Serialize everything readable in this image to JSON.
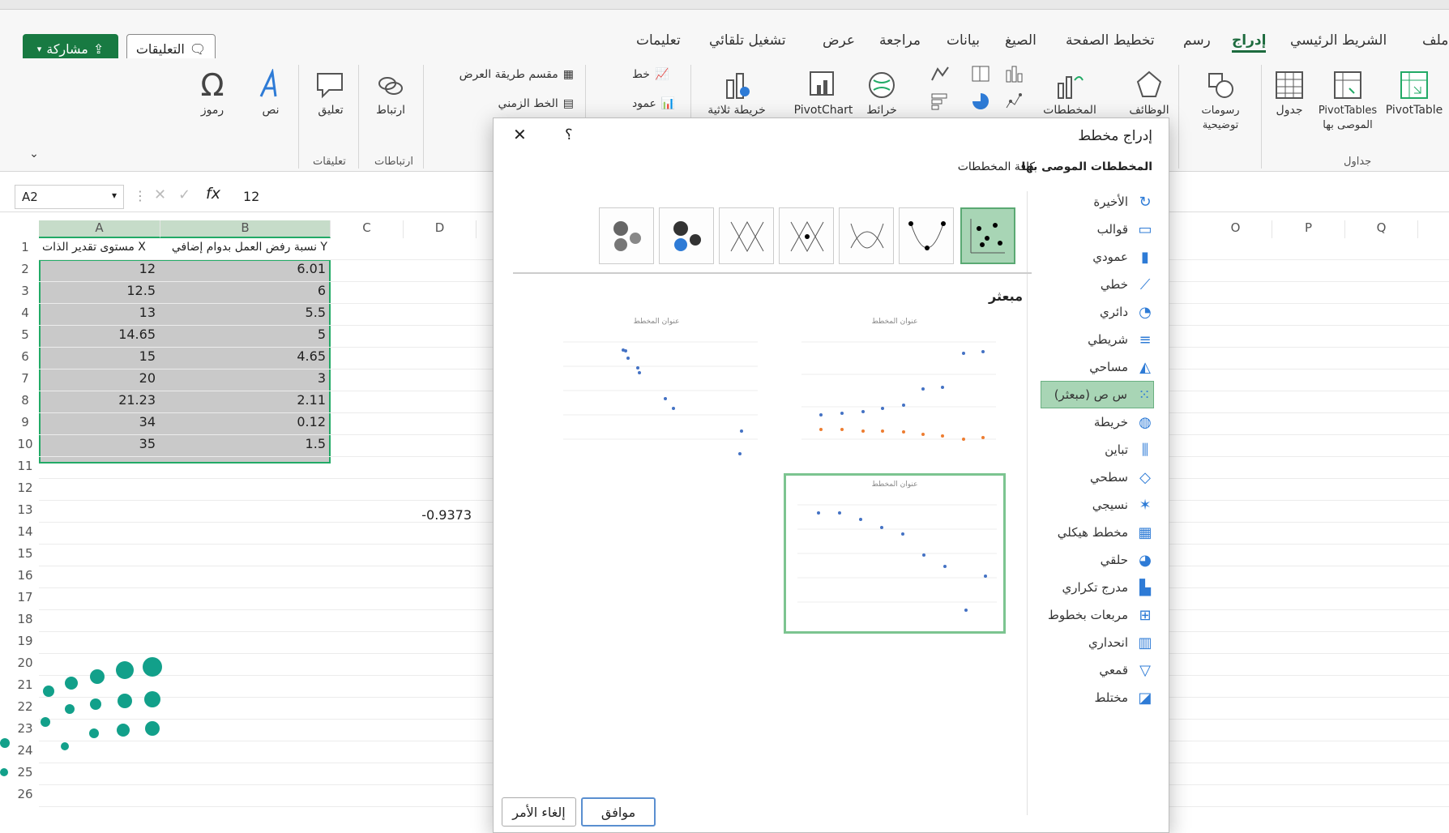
{
  "app": {
    "accent": "#187a42",
    "selection_green": "#a8d5b5"
  },
  "menu": {
    "tabs": [
      "ملف",
      "الشريط الرئيسي",
      "إدراج",
      "رسم",
      "تخطيط الصفحة",
      "الصيغ",
      "بيانات",
      "مراجعة",
      "عرض",
      "تشغيل تلقائي",
      "تعليمات"
    ],
    "active_tab": "إدراج",
    "share_label": "مشاركة",
    "comments_label": "التعليقات"
  },
  "ribbon": {
    "pivottable": "PivotTable",
    "recommended_pivottables": "PivotTables الموصى بها",
    "table": "جدول",
    "tables_group": "جداول",
    "illustrations": "رسومات توضيحية",
    "functions": "الوظائف",
    "charts": "المخططات",
    "maps": "خرائط",
    "pivotchart": "PivotChart",
    "3d_map": "خريطة ثلاثية",
    "line_spark": "خط",
    "column_spark": "عمود",
    "slicer": "مقسم طريقة العرض",
    "timeline": "الخط الزمني",
    "link": "ارتباط",
    "links_group": "ارتباطات",
    "comment": "تعليق",
    "comments_group": "تعليقات",
    "text": "نص",
    "symbols": "رموز"
  },
  "formula_bar": {
    "name_box": "A2",
    "fx": "fx",
    "value": "12"
  },
  "sheet": {
    "columns": [
      "A",
      "B",
      "C",
      "D",
      "O",
      "P",
      "Q"
    ],
    "header_a": "مستوى تقدير الذات X",
    "header_b": "نسبة رفض العمل بدوام إضافي Y",
    "rows": [
      {
        "a": "12",
        "b": "6.01"
      },
      {
        "a": "12.5",
        "b": "6"
      },
      {
        "a": "13",
        "b": "5.5"
      },
      {
        "a": "14.65",
        "b": "5"
      },
      {
        "a": "15",
        "b": "4.65"
      },
      {
        "a": "20",
        "b": "3"
      },
      {
        "a": "21.23",
        "b": "2.11"
      },
      {
        "a": "34",
        "b": "0.12"
      },
      {
        "a": "35",
        "b": "1.5"
      }
    ],
    "d13": "-0.9373",
    "row_numbers": [
      "1",
      "2",
      "3",
      "4",
      "5",
      "6",
      "7",
      "8",
      "9",
      "10",
      "11",
      "12",
      "13",
      "14",
      "15",
      "16",
      "17",
      "18",
      "19",
      "20",
      "21",
      "22",
      "23",
      "24",
      "25",
      "26"
    ]
  },
  "dialog": {
    "title": "إدراج مخطط",
    "help": "؟",
    "close": "✕",
    "tab_recommended": "المخططات الموصى بها",
    "tab_all": "كافة المخططات",
    "section_title": "مبعثر",
    "preview_title": "عنوان المخطط",
    "ok_label": "موافق",
    "cancel_label": "إلغاء الأمر",
    "chart_types": [
      {
        "label": "الأخيرة",
        "icon": "recent-icon"
      },
      {
        "label": "قوالب",
        "icon": "templates-icon"
      },
      {
        "label": "عمودي",
        "icon": "column-chart-icon"
      },
      {
        "label": "خطي",
        "icon": "line-chart-icon"
      },
      {
        "label": "دائري",
        "icon": "pie-chart-icon"
      },
      {
        "label": "شريطي",
        "icon": "bar-chart-icon"
      },
      {
        "label": "مساحي",
        "icon": "area-chart-icon"
      },
      {
        "label": "س ص (مبعثر)",
        "icon": "scatter-chart-icon"
      },
      {
        "label": "خريطة",
        "icon": "map-chart-icon"
      },
      {
        "label": "تباين",
        "icon": "stock-chart-icon"
      },
      {
        "label": "سطحي",
        "icon": "surface-chart-icon"
      },
      {
        "label": "نسيجي",
        "icon": "radar-chart-icon"
      },
      {
        "label": "مخطط هيكلي",
        "icon": "treemap-icon"
      },
      {
        "label": "حلقي",
        "icon": "sunburst-icon"
      },
      {
        "label": "مدرج تكراري",
        "icon": "histogram-icon"
      },
      {
        "label": "مربعات بخطوط",
        "icon": "box-whisker-icon"
      },
      {
        "label": "انحداري",
        "icon": "waterfall-icon"
      },
      {
        "label": "قمعي",
        "icon": "funnel-icon"
      },
      {
        "label": "مختلط",
        "icon": "combo-chart-icon"
      }
    ],
    "selected_type": "س ص (مبعثر)"
  }
}
